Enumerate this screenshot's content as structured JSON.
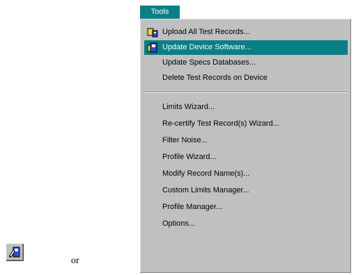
{
  "menu": {
    "title": "Tools",
    "items": [
      {
        "label": "Upload All Test Records...",
        "icon": "upload-icon"
      },
      {
        "label": "Update Device Software...",
        "icon": "update-device-icon",
        "highlighted": true
      },
      {
        "label": "Update Specs Databases..."
      },
      {
        "label": "Delete Test Records on Device"
      },
      {
        "label": "Limits Wizard..."
      },
      {
        "label": "Re-certify Test Record(s) Wizard..."
      },
      {
        "label": "Filter Noise..."
      },
      {
        "label": "Profile Wizard..."
      },
      {
        "label": "Modify Record Name(s)..."
      },
      {
        "label": "Custom Limits Manager..."
      },
      {
        "label": "Profile Manager..."
      },
      {
        "label": "Options..."
      }
    ]
  },
  "toolbar_button": {
    "icon": "update-device-software-icon"
  },
  "or_text": "or",
  "colors": {
    "highlight": "#0a7f86",
    "menu_background": "#c0c0c0"
  }
}
